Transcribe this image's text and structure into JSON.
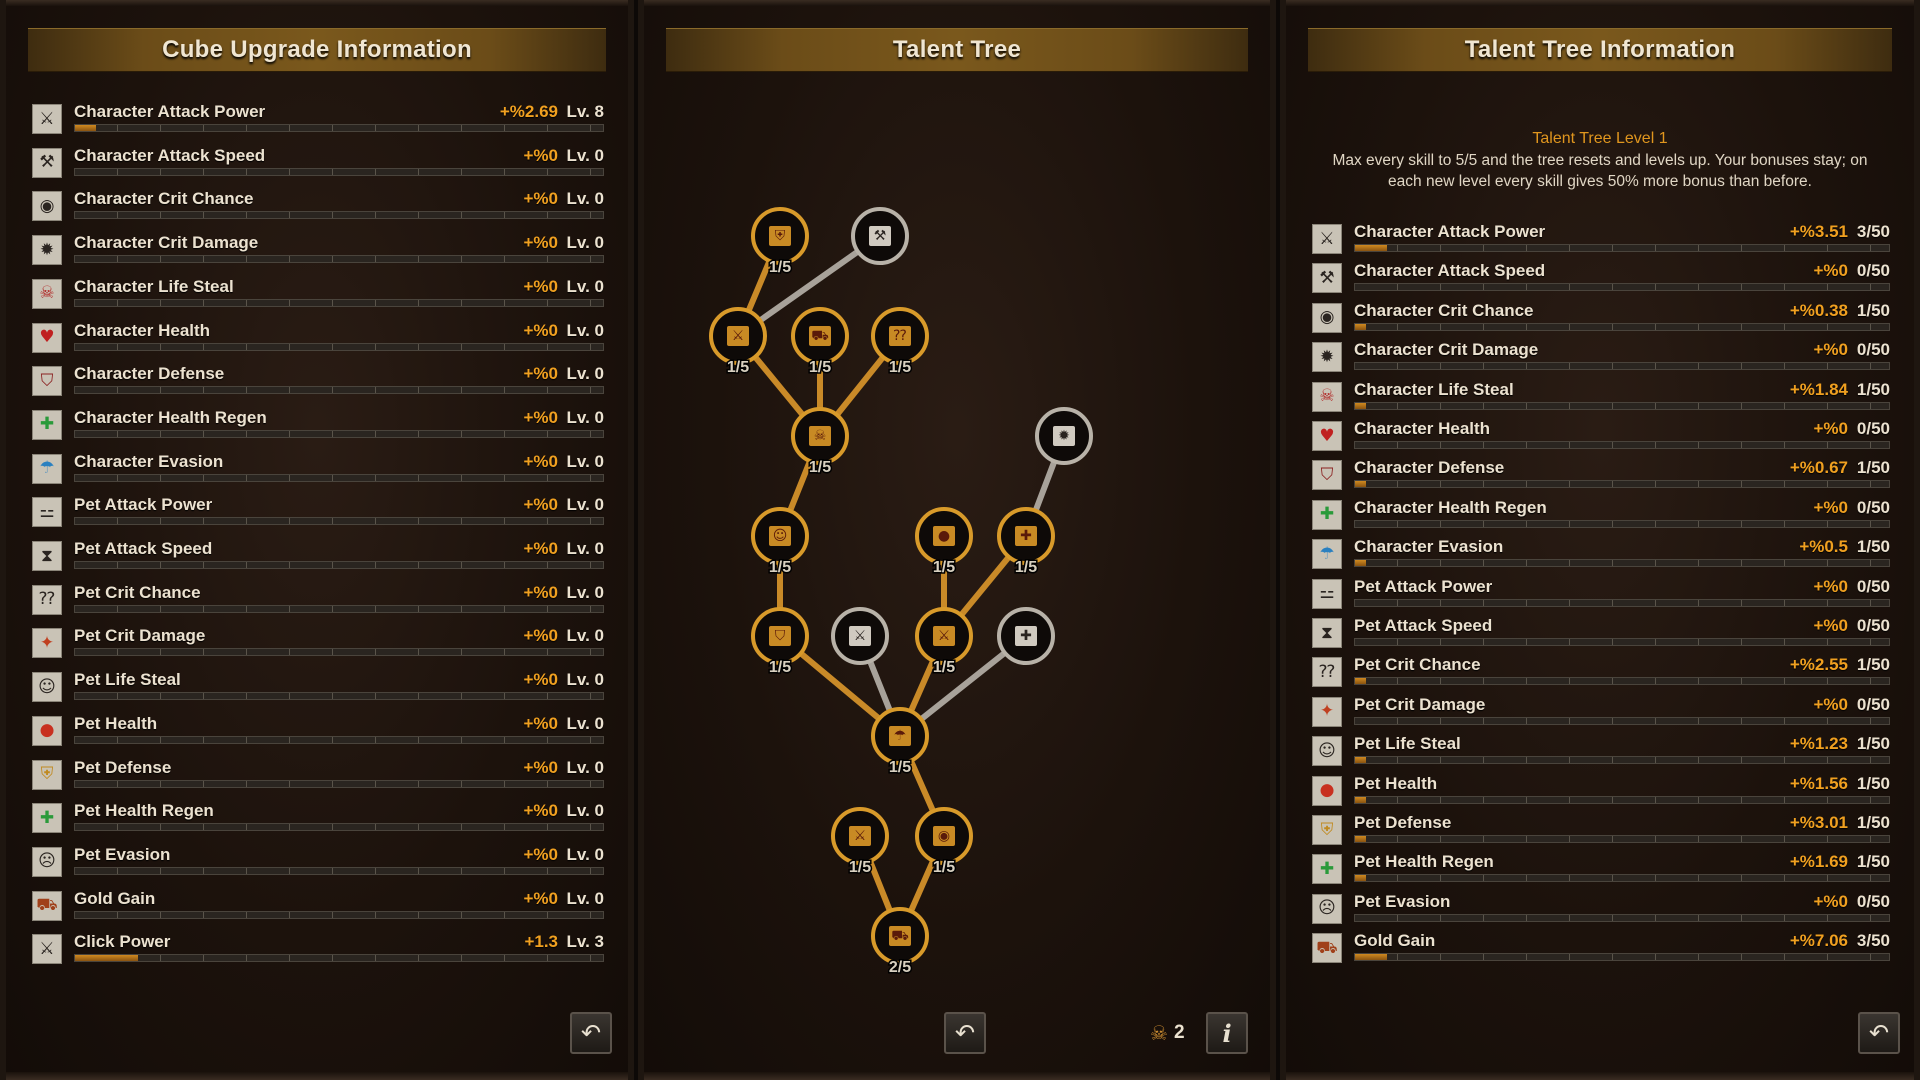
{
  "left_panel": {
    "title": "Cube Upgrade Information",
    "stats": [
      {
        "name": "Character Attack Power",
        "value": "+%2.69",
        "level": "Lv. 8",
        "icon": "sword-icon",
        "progress": 0.04
      },
      {
        "name": "Character Attack Speed",
        "value": "+%0",
        "level": "Lv. 0",
        "icon": "swift-attack-icon",
        "progress": 0
      },
      {
        "name": "Character Crit Chance",
        "value": "+%0",
        "level": "Lv. 0",
        "icon": "eye-icon",
        "progress": 0
      },
      {
        "name": "Character Crit Damage",
        "value": "+%0",
        "level": "Lv. 0",
        "icon": "bomb-icon",
        "progress": 0
      },
      {
        "name": "Character Life Steal",
        "value": "+%0",
        "level": "Lv. 0",
        "icon": "skull-icon",
        "progress": 0
      },
      {
        "name": "Character Health",
        "value": "+%0",
        "level": "Lv. 0",
        "icon": "heart-icon",
        "progress": 0
      },
      {
        "name": "Character Defense",
        "value": "+%0",
        "level": "Lv. 0",
        "icon": "armor-icon",
        "progress": 0
      },
      {
        "name": "Character Health Regen",
        "value": "+%0",
        "level": "Lv. 0",
        "icon": "regen-cross-icon",
        "progress": 0
      },
      {
        "name": "Character Evasion",
        "value": "+%0",
        "level": "Lv. 0",
        "icon": "umbrella-icon",
        "progress": 0
      },
      {
        "name": "Pet Attack Power",
        "value": "+%0",
        "level": "Lv. 0",
        "icon": "bone-icon",
        "progress": 0
      },
      {
        "name": "Pet Attack Speed",
        "value": "+%0",
        "level": "Lv. 0",
        "icon": "hourglass-icon",
        "progress": 0
      },
      {
        "name": "Pet Crit Chance",
        "value": "+%0",
        "level": "Lv. 0",
        "icon": "question-marks-icon",
        "progress": 0
      },
      {
        "name": "Pet Crit Damage",
        "value": "+%0",
        "level": "Lv. 0",
        "icon": "fox-icon",
        "progress": 0
      },
      {
        "name": "Pet Life Steal",
        "value": "+%0",
        "level": "Lv. 0",
        "icon": "pet-face-icon",
        "progress": 0
      },
      {
        "name": "Pet Health",
        "value": "+%0",
        "level": "Lv. 0",
        "icon": "apple-icon",
        "progress": 0
      },
      {
        "name": "Pet Defense",
        "value": "+%0",
        "level": "Lv. 0",
        "icon": "shield-paw-icon",
        "progress": 0
      },
      {
        "name": "Pet Health Regen",
        "value": "+%0",
        "level": "Lv. 0",
        "icon": "plus-icon",
        "progress": 0
      },
      {
        "name": "Pet Evasion",
        "value": "+%0",
        "level": "Lv. 0",
        "icon": "ghost-face-icon",
        "progress": 0
      },
      {
        "name": "Gold Gain",
        "value": "+%0",
        "level": "Lv. 0",
        "icon": "treasure-chest-icon",
        "progress": 0
      },
      {
        "name": "Click Power",
        "value": "+1.3",
        "level": "Lv. 3",
        "icon": "sword-icon",
        "progress": 0.12
      }
    ]
  },
  "middle_panel": {
    "title": "Talent Tree",
    "talent_points": "2",
    "nodes": [
      {
        "id": "n1",
        "label": "1/5",
        "active": true,
        "glyph": "⛨",
        "name": "talent-node-pet-defense"
      },
      {
        "id": "n2",
        "label": "",
        "active": false,
        "glyph": "⚒",
        "name": "talent-node-attack-speed"
      },
      {
        "id": "n3",
        "label": "1/5",
        "active": true,
        "glyph": "⚔",
        "name": "talent-node-attack-power"
      },
      {
        "id": "n4",
        "label": "1/5",
        "active": true,
        "glyph": "⛟",
        "name": "talent-node-gold-gain"
      },
      {
        "id": "n5",
        "label": "1/5",
        "active": true,
        "glyph": "⁇",
        "name": "talent-node-pet-crit-chance"
      },
      {
        "id": "n6",
        "label": "1/5",
        "active": true,
        "glyph": "☠",
        "name": "talent-node-life-steal"
      },
      {
        "id": "n7",
        "label": "",
        "active": false,
        "glyph": "✹",
        "name": "talent-node-crit-damage"
      },
      {
        "id": "n8",
        "label": "1/5",
        "active": true,
        "glyph": "☺",
        "name": "talent-node-pet-life-steal"
      },
      {
        "id": "n9",
        "label": "1/5",
        "active": true,
        "glyph": "●",
        "name": "talent-node-pet-health"
      },
      {
        "id": "n10",
        "label": "1/5",
        "active": true,
        "glyph": "✚",
        "name": "talent-node-pet-health-regen"
      },
      {
        "id": "n11",
        "label": "1/5",
        "active": true,
        "glyph": "⛉",
        "name": "talent-node-defense"
      },
      {
        "id": "n12",
        "label": "",
        "active": false,
        "glyph": "⚔",
        "name": "talent-node-click-power"
      },
      {
        "id": "n13",
        "label": "1/5",
        "active": true,
        "glyph": "⚔",
        "name": "talent-node-attack-power-2"
      },
      {
        "id": "n14",
        "label": "",
        "active": false,
        "glyph": "✚",
        "name": "talent-node-health-regen"
      },
      {
        "id": "n15",
        "label": "1/5",
        "active": true,
        "glyph": "☂",
        "name": "talent-node-evasion"
      },
      {
        "id": "n16",
        "label": "1/5",
        "active": true,
        "glyph": "⚔",
        "name": "talent-node-attack-power-3"
      },
      {
        "id": "n17",
        "label": "1/5",
        "active": true,
        "glyph": "◉",
        "name": "talent-node-crit-chance"
      },
      {
        "id": "n18",
        "label": "2/5",
        "active": true,
        "glyph": "⛟",
        "name": "talent-node-gold-gain-2"
      }
    ],
    "edges": [
      {
        "from": "n1",
        "to": "n3",
        "active": true
      },
      {
        "from": "n2",
        "to": "n3",
        "active": false
      },
      {
        "from": "n3",
        "to": "n6",
        "active": true
      },
      {
        "from": "n4",
        "to": "n6",
        "active": true
      },
      {
        "from": "n5",
        "to": "n6",
        "active": true
      },
      {
        "from": "n6",
        "to": "n8",
        "active": true
      },
      {
        "from": "n8",
        "to": "n11",
        "active": true
      },
      {
        "from": "n7",
        "to": "n10",
        "active": false
      },
      {
        "from": "n10",
        "to": "n13",
        "active": true
      },
      {
        "from": "n9",
        "to": "n13",
        "active": true
      },
      {
        "from": "n11",
        "to": "n15",
        "active": true
      },
      {
        "from": "n12",
        "to": "n15",
        "active": false
      },
      {
        "from": "n13",
        "to": "n15",
        "active": true
      },
      {
        "from": "n14",
        "to": "n15",
        "active": false
      },
      {
        "from": "n15",
        "to": "n17",
        "active": true
      },
      {
        "from": "n16",
        "to": "n18",
        "active": true
      },
      {
        "from": "n17",
        "to": "n18",
        "active": true
      }
    ]
  },
  "right_panel": {
    "title": "Talent Tree Information",
    "level_title": "Talent Tree Level 1",
    "description": "Max every skill to 5/5 and the tree resets and levels up. Your bonuses stay; on each new level every skill gives 50% more bonus than before.",
    "stats": [
      {
        "name": "Character Attack Power",
        "value": "+%3.51",
        "level": "3/50",
        "icon": "sword-icon",
        "progress": 0.06
      },
      {
        "name": "Character Attack Speed",
        "value": "+%0",
        "level": "0/50",
        "icon": "swift-attack-icon",
        "progress": 0
      },
      {
        "name": "Character Crit Chance",
        "value": "+%0.38",
        "level": "1/50",
        "icon": "eye-icon",
        "progress": 0.02
      },
      {
        "name": "Character Crit Damage",
        "value": "+%0",
        "level": "0/50",
        "icon": "bomb-icon",
        "progress": 0
      },
      {
        "name": "Character Life Steal",
        "value": "+%1.84",
        "level": "1/50",
        "icon": "skull-icon",
        "progress": 0.02
      },
      {
        "name": "Character Health",
        "value": "+%0",
        "level": "0/50",
        "icon": "heart-icon",
        "progress": 0
      },
      {
        "name": "Character Defense",
        "value": "+%0.67",
        "level": "1/50",
        "icon": "armor-icon",
        "progress": 0.02
      },
      {
        "name": "Character Health Regen",
        "value": "+%0",
        "level": "0/50",
        "icon": "regen-cross-icon",
        "progress": 0
      },
      {
        "name": "Character Evasion",
        "value": "+%0.5",
        "level": "1/50",
        "icon": "umbrella-icon",
        "progress": 0.02
      },
      {
        "name": "Pet Attack Power",
        "value": "+%0",
        "level": "0/50",
        "icon": "bone-icon",
        "progress": 0
      },
      {
        "name": "Pet Attack Speed",
        "value": "+%0",
        "level": "0/50",
        "icon": "hourglass-icon",
        "progress": 0
      },
      {
        "name": "Pet Crit Chance",
        "value": "+%2.55",
        "level": "1/50",
        "icon": "question-marks-icon",
        "progress": 0.02
      },
      {
        "name": "Pet Crit Damage",
        "value": "+%0",
        "level": "0/50",
        "icon": "fox-icon",
        "progress": 0
      },
      {
        "name": "Pet Life Steal",
        "value": "+%1.23",
        "level": "1/50",
        "icon": "pet-face-icon",
        "progress": 0.02
      },
      {
        "name": "Pet Health",
        "value": "+%1.56",
        "level": "1/50",
        "icon": "apple-icon",
        "progress": 0.02
      },
      {
        "name": "Pet Defense",
        "value": "+%3.01",
        "level": "1/50",
        "icon": "shield-paw-icon",
        "progress": 0.02
      },
      {
        "name": "Pet Health Regen",
        "value": "+%1.69",
        "level": "1/50",
        "icon": "plus-icon",
        "progress": 0.02
      },
      {
        "name": "Pet Evasion",
        "value": "+%0",
        "level": "0/50",
        "icon": "ghost-face-icon",
        "progress": 0
      },
      {
        "name": "Gold Gain",
        "value": "+%7.06",
        "level": "3/50",
        "icon": "treasure-chest-icon",
        "progress": 0.06
      }
    ]
  },
  "colors": {
    "accent": "#f0a020",
    "progress_fill": "#d08a20",
    "active_edge": "#c98a28",
    "inactive_edge": "#a8a29a"
  }
}
